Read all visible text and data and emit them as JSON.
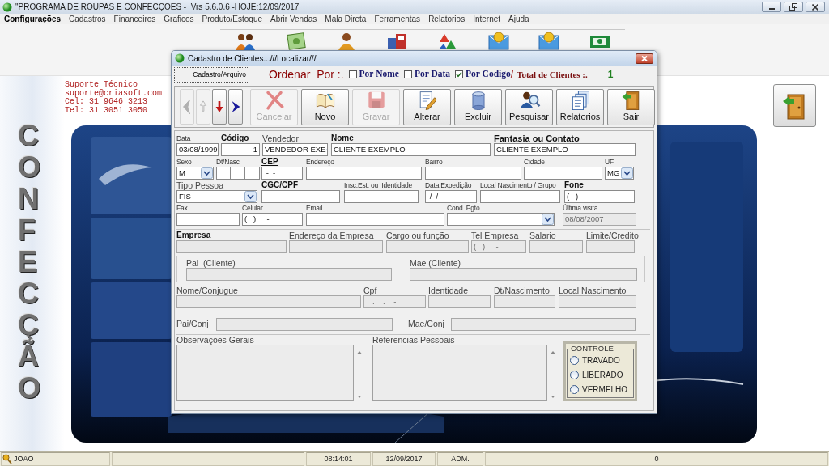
{
  "window": {
    "title": "\"PROGRAMA DE ROUPAS E CONFECÇOES -  Vrs 5.6.0.6 -HOJE:12/09/2017"
  },
  "menu": [
    {
      "label": "Configurações",
      "selected": true
    },
    {
      "label": "Cadastros",
      "selected": false
    },
    {
      "label": "Financeiros",
      "selected": false
    },
    {
      "label": "Graficos",
      "selected": false
    },
    {
      "label": "Produto/Estoque",
      "selected": false
    },
    {
      "label": "Abrir Vendas",
      "selected": false
    },
    {
      "label": "Mala Direta",
      "selected": false
    },
    {
      "label": "Ferramentas",
      "selected": false
    },
    {
      "label": "Relatorios",
      "selected": false
    },
    {
      "label": "Internet",
      "selected": false
    },
    {
      "label": "Ajuda",
      "selected": false
    }
  ],
  "support": [
    "Suporte Técnico",
    "suporte@criasoft.com",
    "Cel: 31 9646 3213",
    "Tel: 31 3051 3050"
  ],
  "side_title": "CONFECÇÃO",
  "dialog": {
    "title": "Cadastro de Clientes...///Localizar///",
    "tab": "Cadastro/Arquivo",
    "sort": {
      "label": "Ordenar  Por :.",
      "options": [
        {
          "label": "Por Nome",
          "checked": false
        },
        {
          "label": "Por Data",
          "checked": false
        },
        {
          "label": "Por Codigo",
          "checked": true
        }
      ],
      "separator": "/",
      "total_label": "Total de Clientes :.",
      "total": "1"
    },
    "nav": [
      {
        "kind": "left",
        "disabled": true
      },
      {
        "kind": "up",
        "disabled": true
      },
      {
        "kind": "down",
        "disabled": false
      },
      {
        "kind": "right",
        "disabled": false
      }
    ],
    "actions": [
      {
        "label": "Cancelar",
        "disabled": true
      },
      {
        "label": "Novo",
        "disabled": false
      },
      {
        "label": "Gravar",
        "disabled": true
      },
      {
        "label": "Alterar",
        "disabled": false
      },
      {
        "label": "Excluir",
        "disabled": false
      },
      {
        "label": "Pesquisar",
        "disabled": false
      },
      {
        "label": "Relatorios",
        "disabled": false
      },
      {
        "label": "Sair",
        "disabled": false
      }
    ],
    "fields": [
      {
        "label": "Data",
        "kind": "text",
        "value": "03/08/1999",
        "disabled": false
      },
      {
        "label": "Código",
        "kind": "text",
        "value": "1",
        "disabled": false
      },
      {
        "label": "Vendedor",
        "kind": "select",
        "value": "VENDEDOR EXE",
        "disabled": false
      },
      {
        "label": "Nome",
        "kind": "text",
        "value": "CLIENTE EXEMPLO",
        "disabled": false
      },
      {
        "label": "Fantasia ou Contato",
        "kind": "text",
        "value": "CLIENTE EXEMPLO",
        "disabled": false
      },
      {
        "label": "Sexo",
        "kind": "select",
        "value": "M",
        "disabled": false
      },
      {
        "label": "Dt/Nasc",
        "kind": "segmented",
        "disabled": false
      },
      {
        "label": "CEP",
        "kind": "text",
        "value": " -  -",
        "disabled": false
      },
      {
        "label": "Endereço",
        "kind": "text",
        "disabled": false
      },
      {
        "label": "Bairro",
        "kind": "text",
        "disabled": false
      },
      {
        "label": "Cidade",
        "kind": "text",
        "disabled": false
      },
      {
        "label": "UF",
        "kind": "select",
        "value": "MG",
        "disabled": false
      },
      {
        "label": "Tipo Pessoa",
        "kind": "select",
        "value": "FIS",
        "disabled": false
      },
      {
        "label": "CGC/CPF",
        "kind": "text",
        "disabled": false
      },
      {
        "label": "Insc.Est. ou  Identidade",
        "kind": "text",
        "disabled": false
      },
      {
        "label": "Data Expedição",
        "kind": "text",
        "value": " /  /",
        "disabled": false
      },
      {
        "label": "Local Nascimento / Grupo",
        "kind": "text",
        "disabled": false
      },
      {
        "label": "Fone",
        "kind": "text",
        "value": "(   )     -",
        "disabled": false
      },
      {
        "label": "Fax",
        "kind": "text",
        "disabled": false
      },
      {
        "label": "Celular",
        "kind": "text",
        "value": "(   )     -",
        "disabled": false
      },
      {
        "label": "Email",
        "kind": "text",
        "disabled": false
      },
      {
        "label": "Cond. Pgto.",
        "kind": "select",
        "disabled": false
      },
      {
        "label": "Última visita",
        "kind": "text",
        "value": "08/08/2007",
        "disabled": true
      }
    ],
    "employment": [
      {
        "label": "Empresa",
        "kind": "text",
        "disabled": true
      },
      {
        "label": "Endereço da Empresa",
        "kind": "text",
        "disabled": true
      },
      {
        "label": "Cargo ou função",
        "kind": "text",
        "disabled": true
      },
      {
        "label": "Tel Empresa",
        "kind": "text",
        "value": "(   )     -",
        "disabled": true
      },
      {
        "label": "Salario",
        "kind": "text",
        "disabled": true
      },
      {
        "label": "Limite/Credito",
        "kind": "text",
        "disabled": true
      }
    ],
    "parents": [
      {
        "label": "Pai  (Cliente)",
        "kind": "text",
        "disabled": true
      },
      {
        "label": "Mae (Cliente)",
        "kind": "text",
        "disabled": true
      }
    ],
    "spouse": [
      {
        "label": "Nome/Conjugue",
        "kind": "text",
        "disabled": true
      },
      {
        "label": "Cpf",
        "kind": "text",
        "value": "   .    .    -",
        "disabled": true
      },
      {
        "label": "Identidade",
        "kind": "text",
        "disabled": true
      },
      {
        "label": "Dt/Nascimento",
        "kind": "text",
        "disabled": true
      },
      {
        "label": "Local Nascimento",
        "kind": "text",
        "disabled": true
      }
    ],
    "spouse_parents": [
      {
        "label": "Pai/Conj",
        "disabled": true
      },
      {
        "label": "Mae/Conj",
        "disabled": true
      }
    ],
    "notes": [
      {
        "label": "Observações Gerais",
        "disabled": true
      },
      {
        "label": "Referencias Pessoais",
        "disabled": true
      }
    ],
    "control": {
      "title": "CONTROLE",
      "options": [
        {
          "label": "TRAVADO",
          "selected": false
        },
        {
          "label": "LIBERADO",
          "selected": false
        },
        {
          "label": "VERMELHO",
          "selected": false
        }
      ]
    }
  },
  "status_bar": {
    "user": "JOAO",
    "time": "08:14:01",
    "date": "12/09/2017",
    "role": "ADM.",
    "count": "0"
  }
}
